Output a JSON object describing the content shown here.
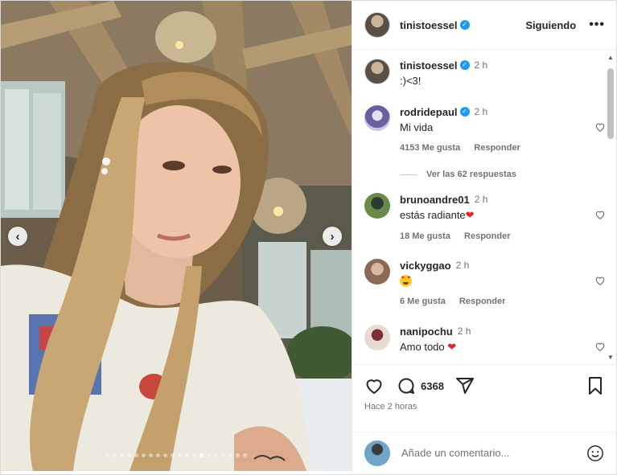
{
  "photo": {
    "prev_glyph": "‹",
    "next_glyph": "›",
    "dots_total": 20,
    "dots_active_index": 13
  },
  "header": {
    "username": "tinistoessel",
    "verified": true,
    "follow_label": "Siguiendo",
    "more_glyph": "•••"
  },
  "caption": {
    "username": "tinistoessel",
    "time": "2 h",
    "text": ":)<3!"
  },
  "comments": [
    {
      "username": "rodridepaul",
      "verified": true,
      "time": "2 h",
      "text": "Mi vida",
      "likes": "4153 Me gusta",
      "reply": "Responder"
    },
    {
      "username": "brunoandre01",
      "verified": false,
      "time": "2 h",
      "text": "estás radiante",
      "emoji": "❤",
      "likes": "18 Me gusta",
      "reply": "Responder"
    },
    {
      "username": "vickyggao",
      "verified": false,
      "time": "2 h",
      "emoji": "heart-eyes-face",
      "likes": "6 Me gusta",
      "reply": "Responder"
    },
    {
      "username": "nanipochu",
      "verified": false,
      "time": "2 h",
      "text": "Amo todo",
      "emoji": "❤"
    }
  ],
  "replies_link": "Ver las 62 respuestas",
  "actions": {
    "comment_count": "6368",
    "time_ago": "Hace 2 horas"
  },
  "add_comment": {
    "placeholder": "Añade un comentario..."
  },
  "colors": {
    "verified": "#1d9bf0",
    "heart": "#e0212b",
    "muted": "#737373",
    "text": "#262626"
  }
}
